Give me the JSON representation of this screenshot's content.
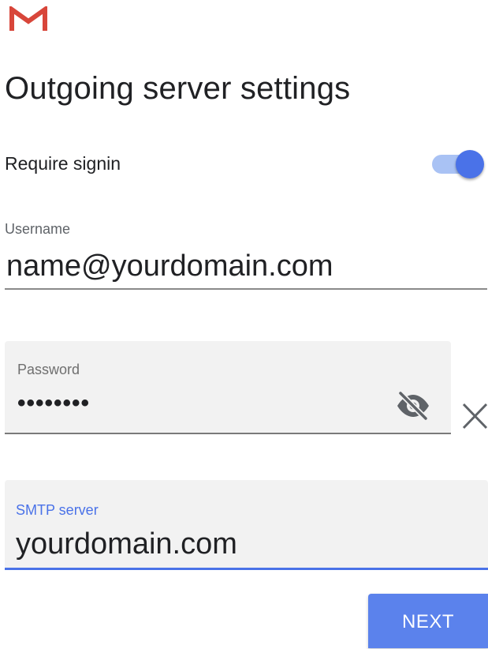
{
  "app": {
    "logo_icon": "gmail-logo-icon",
    "accent_color": "#4a72e8"
  },
  "header": {
    "title": "Outgoing server settings"
  },
  "require_signin": {
    "label": "Require signin",
    "enabled": true
  },
  "username": {
    "label": "Username",
    "value": "name@yourdomain.com"
  },
  "password": {
    "label": "Password",
    "value": "••••••••",
    "visibility_icon": "eye-off-icon",
    "clear_icon": "close-icon"
  },
  "smtp": {
    "label": "SMTP server",
    "value": "yourdomain.com"
  },
  "actions": {
    "next_label": "NEXT"
  }
}
